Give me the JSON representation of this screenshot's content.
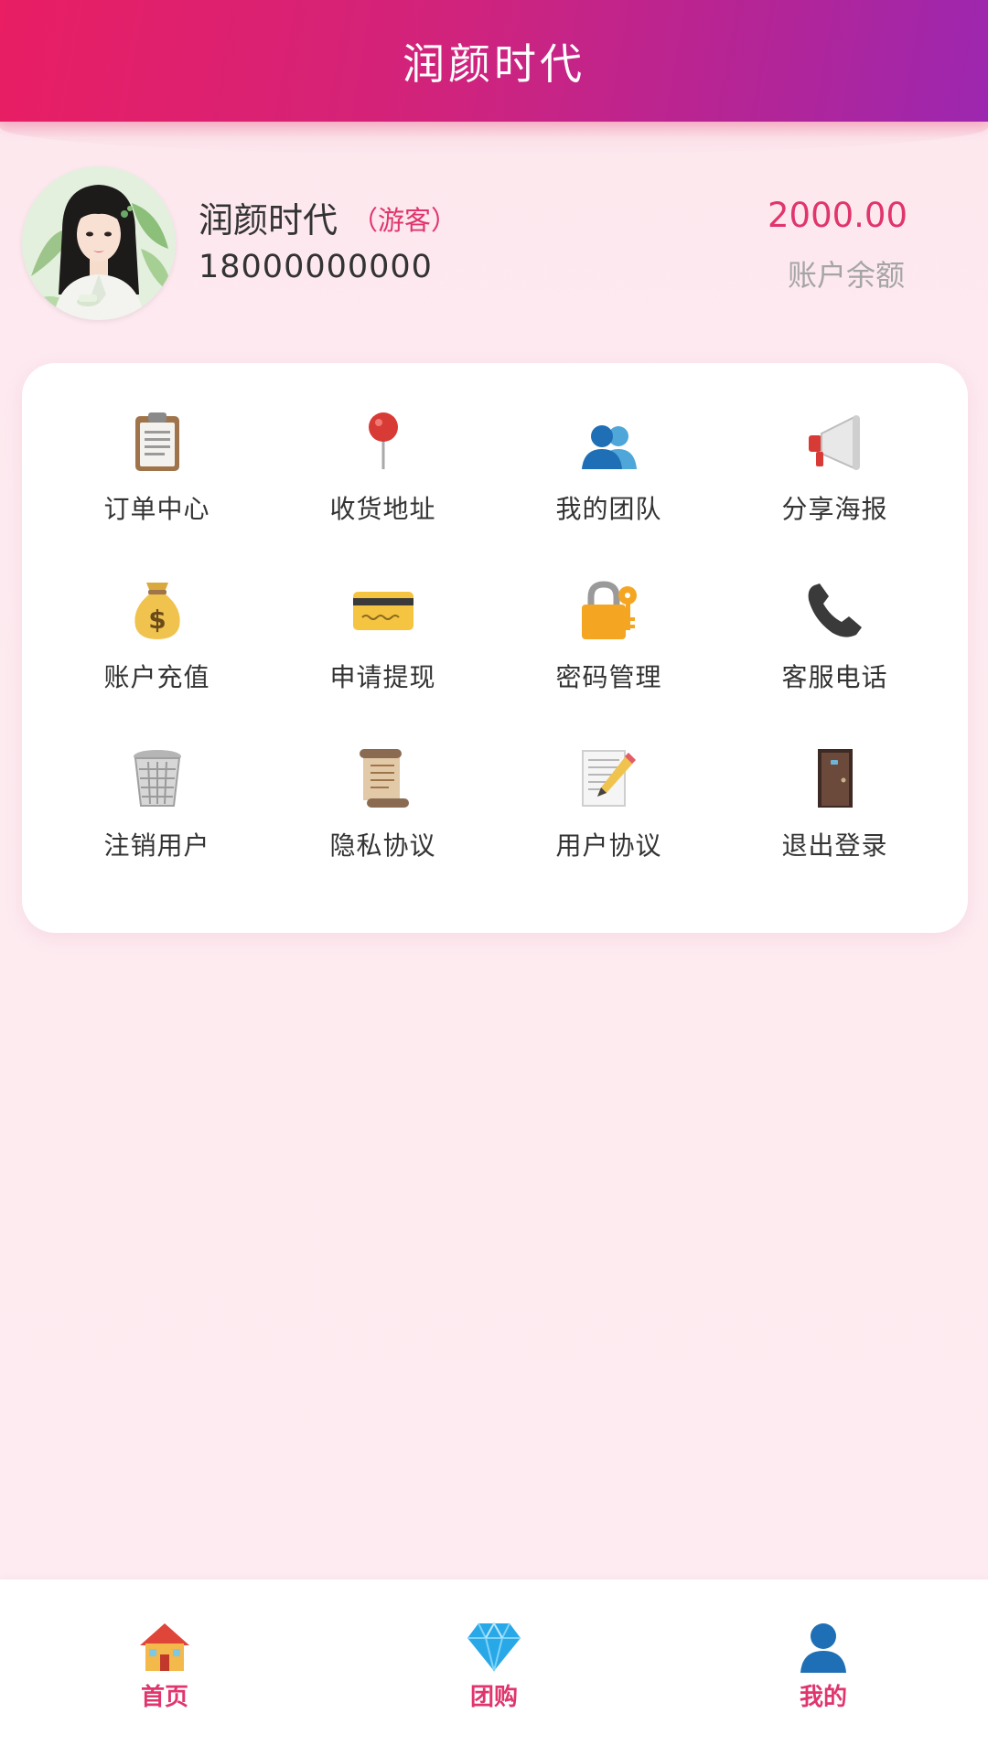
{
  "header": {
    "title": "润颜时代"
  },
  "profile": {
    "name": "润颜时代",
    "tag": "（游客）",
    "phone": "18000000000",
    "balance_amount": "2000.00",
    "balance_label": "账户余额",
    "avatar_icon": "avatar-portrait"
  },
  "menu": {
    "items": [
      {
        "label": "订单中心",
        "icon": "clipboard-icon"
      },
      {
        "label": "收货地址",
        "icon": "map-pin-icon"
      },
      {
        "label": "我的团队",
        "icon": "team-icon"
      },
      {
        "label": "分享海报",
        "icon": "megaphone-icon"
      },
      {
        "label": "账户充值",
        "icon": "money-bag-icon"
      },
      {
        "label": "申请提现",
        "icon": "credit-card-icon"
      },
      {
        "label": "密码管理",
        "icon": "lock-key-icon"
      },
      {
        "label": "客服电话",
        "icon": "phone-icon"
      },
      {
        "label": "注销用户",
        "icon": "trash-icon"
      },
      {
        "label": "隐私协议",
        "icon": "scroll-icon"
      },
      {
        "label": "用户协议",
        "icon": "memo-icon"
      },
      {
        "label": "退出登录",
        "icon": "door-icon"
      }
    ]
  },
  "nav": {
    "items": [
      {
        "label": "首页",
        "icon": "house-icon"
      },
      {
        "label": "团购",
        "icon": "diamond-icon"
      },
      {
        "label": "我的",
        "icon": "user-icon"
      }
    ]
  },
  "colors": {
    "accent": "#e0356d",
    "header_start": "#e91e63",
    "header_end": "#9c27b0",
    "background": "#fde9ef",
    "card": "#ffffff"
  }
}
